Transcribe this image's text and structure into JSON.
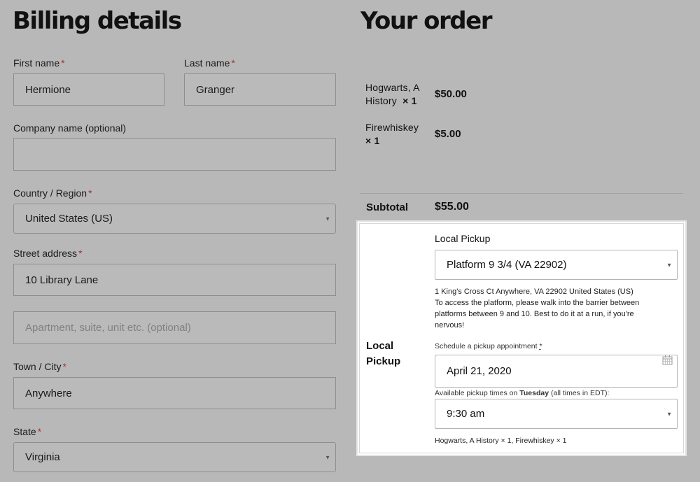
{
  "billing": {
    "title": "Billing details",
    "required_marker": "*",
    "first_name": {
      "label": "First name",
      "value": "Hermione"
    },
    "last_name": {
      "label": "Last name",
      "value": "Granger"
    },
    "company": {
      "label": "Company name (optional)",
      "value": ""
    },
    "country": {
      "label": "Country / Region",
      "value": "United States (US)"
    },
    "street": {
      "label": "Street address",
      "value": "10 Library Lane"
    },
    "apartment": {
      "placeholder": "Apartment, suite, unit etc. (optional)"
    },
    "town": {
      "label": "Town / City",
      "value": "Anywhere"
    },
    "state": {
      "label": "State",
      "value": "Virginia"
    }
  },
  "order": {
    "title": "Your order",
    "items": [
      {
        "name_line1": "Hogwarts, A",
        "name_line2": "History",
        "qty": "× 1",
        "price": "$50.00"
      },
      {
        "name_line1": "Firewhiskey",
        "qty": "× 1",
        "price": "$5.00"
      }
    ],
    "subtotal_label": "Subtotal",
    "subtotal_value": "$55.00"
  },
  "pickup": {
    "row_label_line1": "Local",
    "row_label_line2": "Pickup",
    "heading": "Local Pickup",
    "location": "Platform 9 3/4 (VA 22902)",
    "address": "1 King's Cross Ct Anywhere, VA 22902 United States (US)",
    "note_line1": "To access the platform, please walk into the barrier between",
    "note_line2": "platforms between 9 and 10. Best to do it at a run, if you're",
    "note_line3": "nervous!",
    "schedule_label": "Schedule a pickup appointment",
    "required_marker": "*",
    "date": "April 21, 2020",
    "times_prefix": "Available pickup times on",
    "times_day": "Tuesday",
    "times_suffix": "(all times in EDT):",
    "time": "9:30 am",
    "items_summary": "Hogwarts, A History × 1, Firewhiskey × 1"
  },
  "icons": {
    "caret": "chevron-down-icon",
    "calendar": "calendar-icon"
  }
}
